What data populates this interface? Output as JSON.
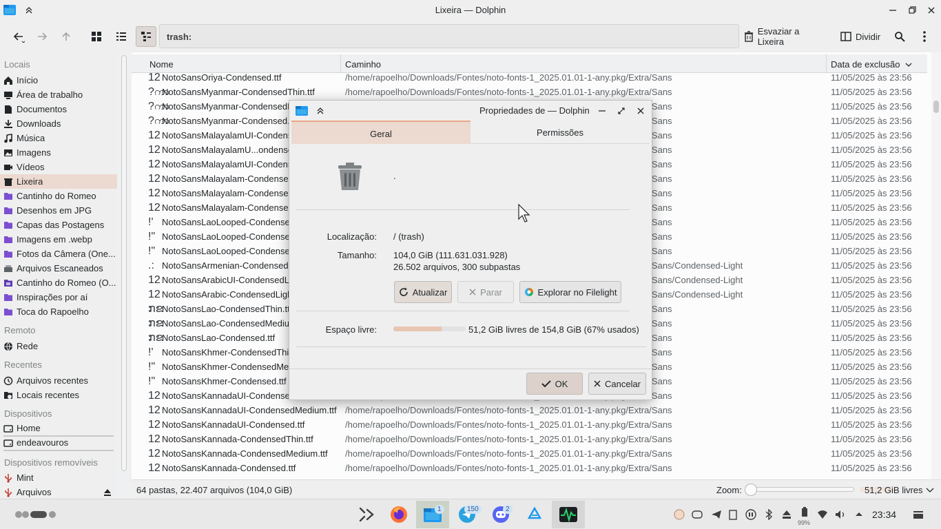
{
  "window": {
    "title": "Lixeira — Dolphin"
  },
  "toolbar": {
    "address": "trash:",
    "empty_trash": "Esvaziar a Lixeira",
    "split": "Dividir"
  },
  "sidebar": {
    "sections": {
      "places": "Locais",
      "remote": "Remoto",
      "recent": "Recentes",
      "devices": "Dispositivos",
      "removable": "Dispositivos removíveis"
    },
    "places": [
      {
        "label": "Início",
        "icon": "home-icon"
      },
      {
        "label": "Área de trabalho",
        "icon": "desktop-icon"
      },
      {
        "label": "Documentos",
        "icon": "document-icon"
      },
      {
        "label": "Downloads",
        "icon": "download-icon"
      },
      {
        "label": "Música",
        "icon": "music-icon"
      },
      {
        "label": "Imagens",
        "icon": "image-icon"
      },
      {
        "label": "Vídeos",
        "icon": "video-icon"
      },
      {
        "label": "Lixeira",
        "icon": "trash-icon"
      },
      {
        "label": "Cantinho do Romeo",
        "icon": "folder-icon"
      },
      {
        "label": "Desenhos em JPG",
        "icon": "folder-icon"
      },
      {
        "label": "Capas das Postagens",
        "icon": "folder-icon"
      },
      {
        "label": "Imagens em .webp",
        "icon": "folder-icon"
      },
      {
        "label": "Fotos da Câmera (One...",
        "icon": "folder-icon"
      },
      {
        "label": "Arquivos Escaneados",
        "icon": "scanner-icon"
      },
      {
        "label": "Cantinho do Romeo (O...",
        "icon": "folder-image-icon"
      },
      {
        "label": "Inspirações por aí",
        "icon": "folder-icon"
      },
      {
        "label": "Toca do Rapoelho",
        "icon": "folder-icon"
      }
    ],
    "remote": [
      {
        "label": "Rede",
        "icon": "network-icon"
      }
    ],
    "recent": [
      {
        "label": "Arquivos recentes",
        "icon": "clock-icon"
      },
      {
        "label": "Locais recentes",
        "icon": "folder-clock-icon"
      }
    ],
    "devices": [
      {
        "label": "Home",
        "icon": "drive-icon"
      },
      {
        "label": "endeavouros",
        "icon": "drive-icon"
      }
    ],
    "removable": [
      {
        "label": "Mint",
        "icon": "usb-icon"
      },
      {
        "label": "Arquivos",
        "icon": "usb-icon"
      }
    ]
  },
  "table": {
    "columns": [
      "Nome",
      "Caminho",
      "Data de exclusão"
    ],
    "rows": [
      {
        "glyph": "12",
        "name": "NotoSansOriya-Condensed.ttf",
        "path": "/home/rapoelho/Downloads/Fontes/noto-fonts-1_2025.01.01-1-any.pkg/Extra/Sans",
        "date": "11/05/2025 às 23:56"
      },
      {
        "glyph": "?ကာ",
        "name": "NotoSansMyanmar-CondensedThin.ttf",
        "path": "/home/rapoelho/Downloads/Fontes/noto-fonts-1_2025.01.01-1-any.pkg/Extra/Sans",
        "date": "11/05/2025 às 23:56"
      },
      {
        "glyph": "?ကာ",
        "name": "NotoSansMyanmar-CondensedMedium.ttf",
        "path": "/home/rapoelho/Downloads/Fontes/noto-fonts-1_2025.01.01-1-any.pkg/Extra/Sans",
        "date": "11/05/2025 às 23:56"
      },
      {
        "glyph": "?ကာ",
        "name": "NotoSansMyanmar-Condensed.ttf",
        "path": "/home/rapoelho/Downloads/Fontes/noto-fonts-1_2025.01.01-1-any.pkg/Extra/Sans",
        "date": "11/05/2025 às 23:56"
      },
      {
        "glyph": "12",
        "name": "NotoSansMalayalamUI-CondensedThin.ttf",
        "path": "/home/rapoelho/Downloads/Fontes/noto-fonts-1_2025.01.01-1-any.pkg/Extra/Sans",
        "date": "11/05/2025 às 23:56"
      },
      {
        "glyph": "12",
        "name": "NotoSansMalayalamU...ondensedMedium.ttf",
        "path": "/home/rapoelho/Downloads/Fontes/noto-fonts-1_2025.01.01-1-any.pkg/Extra/Sans",
        "date": "11/05/2025 às 23:56"
      },
      {
        "glyph": "12",
        "name": "NotoSansMalayalamUI-Condensed.ttf",
        "path": "/home/rapoelho/Downloads/Fontes/noto-fonts-1_2025.01.01-1-any.pkg/Extra/Sans",
        "date": "11/05/2025 às 23:56"
      },
      {
        "glyph": "12",
        "name": "NotoSansMalayalam-CondensedThin.ttf",
        "path": "/home/rapoelho/Downloads/Fontes/noto-fonts-1_2025.01.01-1-any.pkg/Extra/Sans",
        "date": "11/05/2025 às 23:56"
      },
      {
        "glyph": "12",
        "name": "NotoSansMalayalam-CondensedMedium.ttf",
        "path": "/home/rapoelho/Downloads/Fontes/noto-fonts-1_2025.01.01-1-any.pkg/Extra/Sans",
        "date": "11/05/2025 às 23:56"
      },
      {
        "glyph": "12",
        "name": "NotoSansMalayalam-Condensed.ttf",
        "path": "/home/rapoelho/Downloads/Fontes/noto-fonts-1_2025.01.01-1-any.pkg/Extra/Sans",
        "date": "11/05/2025 às 23:56"
      },
      {
        "glyph": "!'",
        "name": "NotoSansLaoLooped-CondensedThin.ttf",
        "path": "/home/rapoelho/Downloads/Fontes/noto-fonts-1_2025.01.01-1-any.pkg/Extra/Sans",
        "date": "11/05/2025 às 23:56"
      },
      {
        "glyph": "!\"",
        "name": "NotoSansLaoLooped-CondensedMedium.ttf",
        "path": "/home/rapoelho/Downloads/Fontes/noto-fonts-1_2025.01.01-1-any.pkg/Extra/Sans",
        "date": "11/05/2025 às 23:56"
      },
      {
        "glyph": "!\"",
        "name": "NotoSansLaoLooped-Condensed.ttf",
        "path": "/home/rapoelho/Downloads/Fontes/noto-fonts-1_2025.01.01-1-any.pkg/Extra/Sans",
        "date": "11/05/2025 às 23:56"
      },
      {
        "glyph": ".:",
        "name": "NotoSansArmenian-CondensedLight.ttf",
        "path": "/home/rapoelho/Downloads/Fontes/noto-fonts-1_2025.01.01-1-any.pkg/Extra/Sans/Condensed-Light",
        "date": "11/05/2025 às 23:56"
      },
      {
        "glyph": "12",
        "name": "NotoSansArabicUI-CondensedLight.ttf",
        "path": "/home/rapoelho/Downloads/Fontes/noto-fonts-1_2025.01.01-1-any.pkg/Extra/Sans/Condensed-Light",
        "date": "11/05/2025 às 23:56"
      },
      {
        "glyph": "12",
        "name": "NotoSansArabic-CondensedLight.ttf",
        "path": "/home/rapoelho/Downloads/Fontes/noto-fonts-1_2025.01.01-1-any.pkg/Extra/Sans/Condensed-Light",
        "date": "11/05/2025 às 23:56"
      },
      {
        "glyph": "ກຂ",
        "name": "NotoSansLao-CondensedThin.ttf",
        "path": "/home/rapoelho/Downloads/Fontes/noto-fonts-1_2025.01.01-1-any.pkg/Extra/Sans",
        "date": "11/05/2025 às 23:56"
      },
      {
        "glyph": "ກຂ",
        "name": "NotoSansLao-CondensedMedium.ttf",
        "path": "/home/rapoelho/Downloads/Fontes/noto-fonts-1_2025.01.01-1-any.pkg/Extra/Sans",
        "date": "11/05/2025 às 23:56"
      },
      {
        "glyph": "ກຂ",
        "name": "NotoSansLao-Condensed.ttf",
        "path": "/home/rapoelho/Downloads/Fontes/noto-fonts-1_2025.01.01-1-any.pkg/Extra/Sans",
        "date": "11/05/2025 às 23:56"
      },
      {
        "glyph": "!'",
        "name": "NotoSansKhmer-CondensedThin.ttf",
        "path": "/home/rapoelho/Downloads/Fontes/noto-fonts-1_2025.01.01-1-any.pkg/Extra/Sans",
        "date": "11/05/2025 às 23:56"
      },
      {
        "glyph": "!\"",
        "name": "NotoSansKhmer-CondensedMedium.ttf",
        "path": "/home/rapoelho/Downloads/Fontes/noto-fonts-1_2025.01.01-1-any.pkg/Extra/Sans",
        "date": "11/05/2025 às 23:56"
      },
      {
        "glyph": "!\"",
        "name": "NotoSansKhmer-Condensed.ttf",
        "path": "/home/rapoelho/Downloads/Fontes/noto-fonts-1_2025.01.01-1-any.pkg/Extra/Sans",
        "date": "11/05/2025 às 23:56"
      },
      {
        "glyph": "12",
        "name": "NotoSansKannadaUI-CondensedThin.ttf",
        "path": "/home/rapoelho/Downloads/Fontes/noto-fonts-1_2025.01.01-1-any.pkg/Extra/Sans",
        "date": "11/05/2025 às 23:56"
      },
      {
        "glyph": "12",
        "name": "NotoSansKannadaUI-CondensedMedium.ttf",
        "path": "/home/rapoelho/Downloads/Fontes/noto-fonts-1_2025.01.01-1-any.pkg/Extra/Sans",
        "date": "11/05/2025 às 23:56"
      },
      {
        "glyph": "12",
        "name": "NotoSansKannadaUI-Condensed.ttf",
        "path": "/home/rapoelho/Downloads/Fontes/noto-fonts-1_2025.01.01-1-any.pkg/Extra/Sans",
        "date": "11/05/2025 às 23:56"
      },
      {
        "glyph": "12",
        "name": "NotoSansKannada-CondensedThin.ttf",
        "path": "/home/rapoelho/Downloads/Fontes/noto-fonts-1_2025.01.01-1-any.pkg/Extra/Sans",
        "date": "11/05/2025 às 23:56"
      },
      {
        "glyph": "12",
        "name": "NotoSansKannada-CondensedMedium.ttf",
        "path": "/home/rapoelho/Downloads/Fontes/noto-fonts-1_2025.01.01-1-any.pkg/Extra/Sans",
        "date": "11/05/2025 às 23:56"
      },
      {
        "glyph": "12",
        "name": "NotoSansKannada-Condensed.ttf",
        "path": "/home/rapoelho/Downloads/Fontes/noto-fonts-1_2025.01.01-1-any.pkg/Extra/Sans",
        "date": "11/05/2025 às 23:56"
      }
    ]
  },
  "statusbar": {
    "summary": "64 pastas, 22.407 arquivos (104,0 GiB)",
    "zoom_label": "Zoom:",
    "free_space": "51,2 GiB livres"
  },
  "dialog": {
    "title": "Propriedades de — Dolphin",
    "tabs": [
      "Geral",
      "Permissões"
    ],
    "name_value": ".",
    "location_label": "Localização:",
    "location_value": "/ (trash)",
    "size_label": "Tamanho:",
    "size_value": "104,0 GiB (111.631.031.928)",
    "contents_value": "26.502 arquivos, 300 subpastas",
    "buttons": {
      "refresh": "Atualizar",
      "stop": "Parar",
      "filelight": "Explorar no Filelight",
      "ok": "OK",
      "cancel": "Cancelar"
    },
    "free_label": "Espaço livre:",
    "free_value": "51,2 GiB livres de 154,8 GiB (67% usados)",
    "used_fraction": 0.67
  },
  "taskbar": {
    "clock": "23:34",
    "badges": {
      "dolphin": "1",
      "telegram": "150",
      "discord": "2"
    },
    "battery": "99%"
  },
  "colors": {
    "accent": "#e8a686",
    "selection": "#ecd9cf",
    "text": "#232629"
  }
}
